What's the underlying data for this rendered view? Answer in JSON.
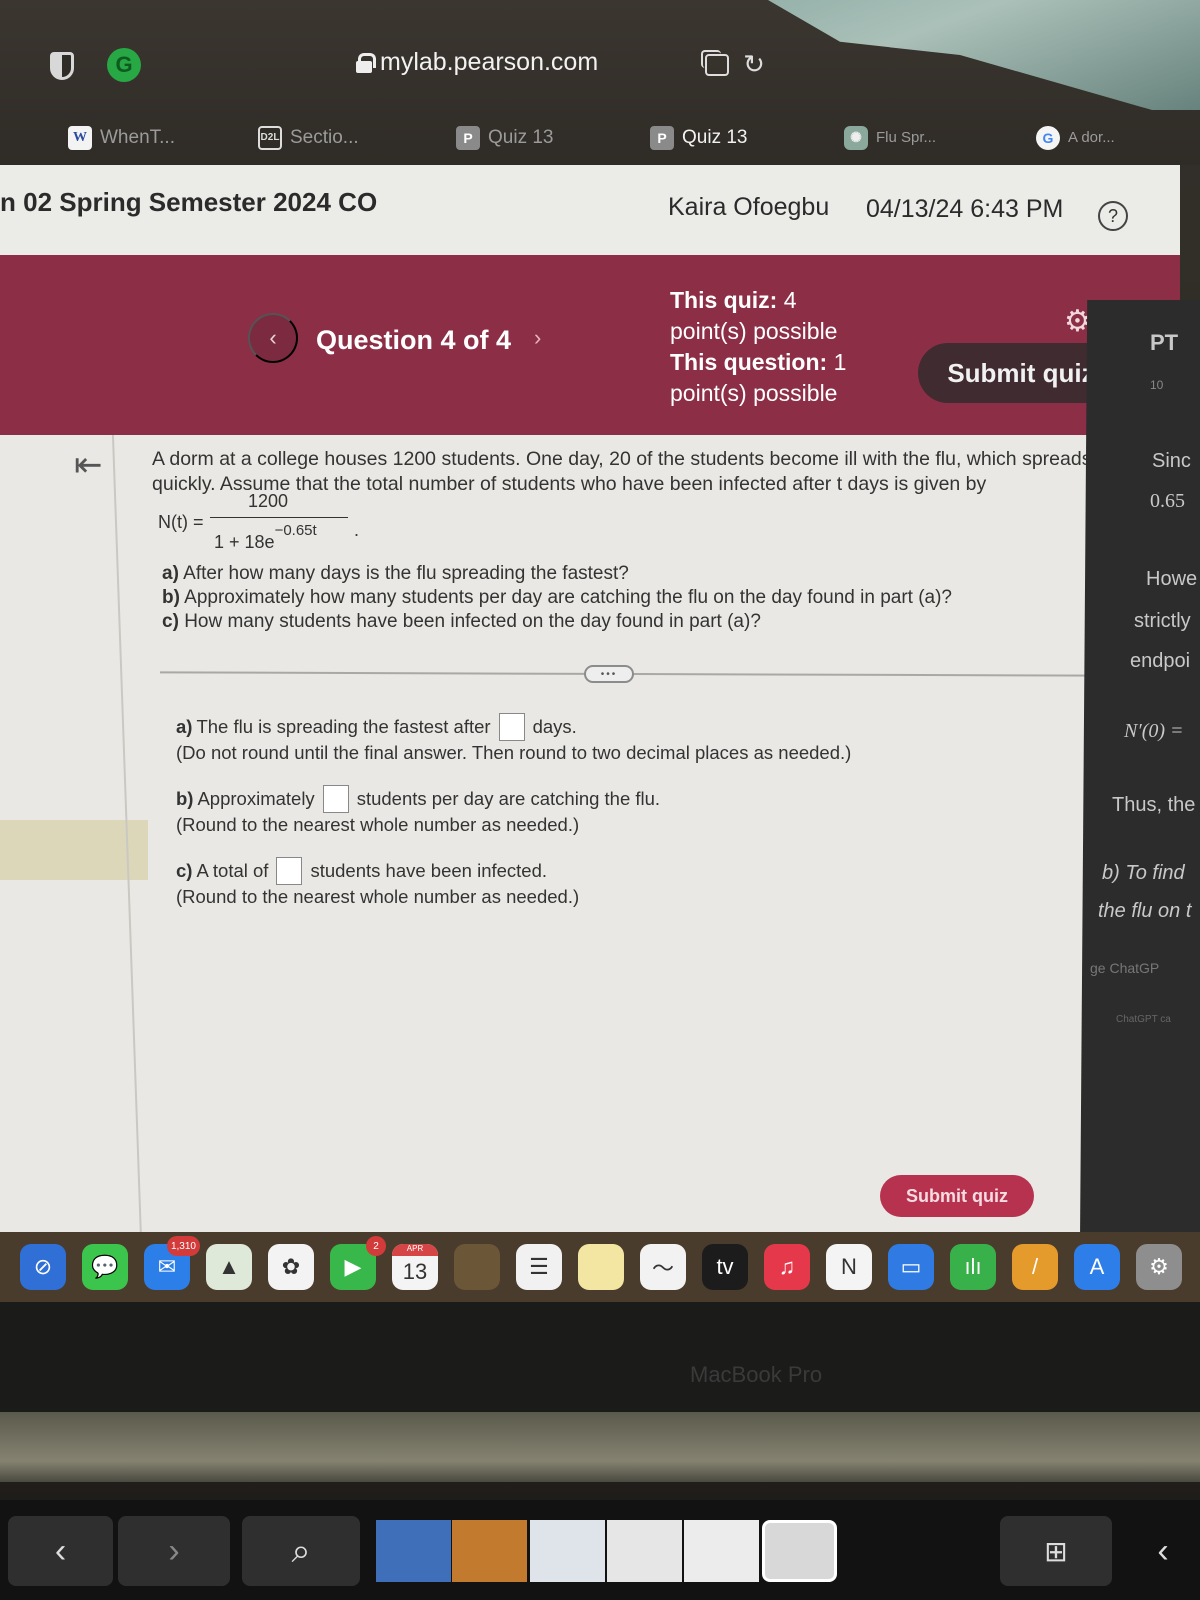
{
  "browser": {
    "url": "mylab.pearson.com",
    "tabs": [
      {
        "label": "WhenT...",
        "favicon": "W",
        "active": false
      },
      {
        "label": "Sectio...",
        "favicon": "D2L",
        "active": false
      },
      {
        "label": "Quiz 13",
        "favicon": "P",
        "active": false
      },
      {
        "label": "Quiz 13",
        "favicon": "P",
        "active": true
      },
      {
        "label": "Flu Spr...",
        "favicon": "chatgpt-icon",
        "active": false
      },
      {
        "label": "A dor...",
        "favicon": "G",
        "active": false
      }
    ],
    "extension_icons": [
      "shield-icon",
      "grammarly-icon"
    ],
    "grammarly_letter": "G"
  },
  "header": {
    "course_title": "n 02 Spring Semester 2024 CO",
    "user_name": "Kaira Ofoegbu",
    "datetime": "04/13/24 6:43 PM",
    "help_symbol": "?"
  },
  "banner": {
    "question_label": "Question 4 of 4",
    "prev_symbol": "‹",
    "next_symbol": "›",
    "quiz_points_label": "This quiz:",
    "quiz_points_value": "4",
    "quiz_points_suffix": "point(s) possible",
    "question_points_label": "This question:",
    "question_points_value": "1",
    "question_points_suffix": "point(s) possible",
    "submit_label": "Submit quiz",
    "brand_color": "#8c2e46"
  },
  "question": {
    "intro": "A dorm at a college houses 1200 students. One day, 20 of the students become ill with the flu, which spreads quickly. Assume that the total number of students who have been infected after t days is given by",
    "formula": {
      "lhs": "N(t) =",
      "numerator": "1200",
      "denominator_base": "1 + 18e",
      "denominator_exp": "−0.65t",
      "trailing": "."
    },
    "parts": [
      {
        "letter": "a)",
        "text": "After how many days is the flu spreading the fastest?"
      },
      {
        "letter": "b)",
        "text": "Approximately how many students per day are catching the flu on the day found in part (a)?"
      },
      {
        "letter": "c)",
        "text": "How many students have been infected on the day found in part (a)?"
      }
    ],
    "more_symbol": "•••"
  },
  "answers": [
    {
      "letter": "a)",
      "before": "The flu is spreading the fastest after",
      "after": "days.",
      "value": "",
      "hint": "(Do not round until the final answer. Then round to two decimal places as needed.)"
    },
    {
      "letter": "b)",
      "before": "Approximately",
      "after": "students per day are catching the flu.",
      "value": "",
      "hint": "(Round to the nearest whole number as needed.)"
    },
    {
      "letter": "c)",
      "before": "A total of",
      "after": "students have been infected.",
      "value": "",
      "hint": "(Round to the nearest whole number as needed.)"
    }
  ],
  "footer": {
    "submit_label": "Submit quiz"
  },
  "side_panel": {
    "lines": [
      "PT",
      "10",
      "Sinc",
      "0.65",
      "Howe",
      "strictly",
      "endpoi",
      "N′(0) =",
      "Thus, the",
      "b) To find",
      "the flu on t",
      "ge ChatGP",
      "ChatGPT ca"
    ]
  },
  "dock": {
    "apps": [
      {
        "name": "safari",
        "color": "#2f6fd6",
        "glyph": "⊘"
      },
      {
        "name": "messages",
        "color": "#3cc54c",
        "glyph": "💬"
      },
      {
        "name": "mail",
        "color": "#2c7ee8",
        "glyph": "✉",
        "badge": "1,310"
      },
      {
        "name": "maps",
        "color": "#dfe9d9",
        "glyph": "▲"
      },
      {
        "name": "photos",
        "color": "#f3f3f3",
        "glyph": "✿"
      },
      {
        "name": "facetime",
        "color": "#38b84a",
        "glyph": "▶",
        "badge": "2"
      },
      {
        "name": "calendar",
        "color": "#f4f4f4",
        "glyph": "13",
        "subtitle": "APR"
      },
      {
        "name": "finder-blurred",
        "color": "#6b5638",
        "glyph": ""
      },
      {
        "name": "reminders",
        "color": "#f1f1f1",
        "glyph": "☰"
      },
      {
        "name": "notes",
        "color": "#f3e6a2",
        "glyph": ""
      },
      {
        "name": "freeform",
        "color": "#f2f2f2",
        "glyph": "〜"
      },
      {
        "name": "apple-tv",
        "color": "#1c1c1c",
        "glyph": "tv"
      },
      {
        "name": "music",
        "color": "#e5394b",
        "glyph": "♫"
      },
      {
        "name": "news",
        "color": "#f4f4f4",
        "glyph": "N"
      },
      {
        "name": "keynote",
        "color": "#2f7be3",
        "glyph": "▭"
      },
      {
        "name": "numbers",
        "color": "#39b14a",
        "glyph": "ılı"
      },
      {
        "name": "pages",
        "color": "#e59a2c",
        "glyph": "/"
      },
      {
        "name": "app-store",
        "color": "#2d7ee9",
        "glyph": "A"
      },
      {
        "name": "system-settings",
        "color": "#8e8e8e",
        "glyph": "⚙"
      }
    ]
  },
  "laptop": {
    "label": "MacBook Pro",
    "touchbar": {
      "back": "‹",
      "forward": "›",
      "search": "⌕",
      "new_tab": "⊞",
      "collapse": "‹"
    }
  }
}
